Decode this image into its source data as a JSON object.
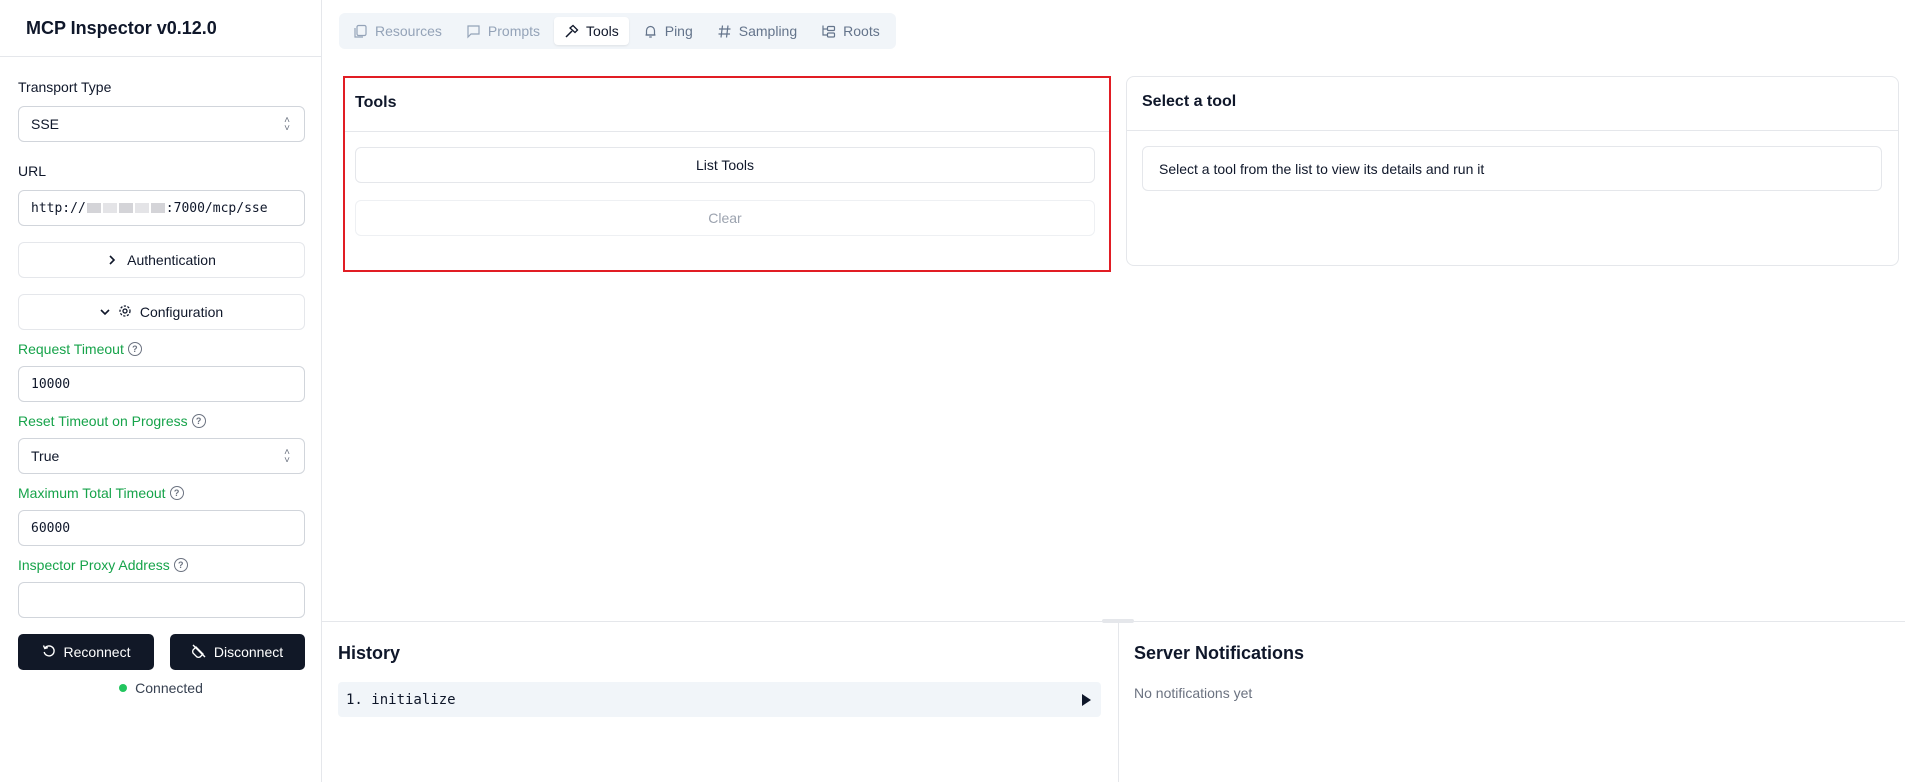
{
  "app": {
    "title": "MCP Inspector v0.12.0"
  },
  "sidebar": {
    "transport_label": "Transport Type",
    "transport_value": "SSE",
    "url_label": "URL",
    "url_prefix": "http://",
    "url_suffix": ":7000/mcp/sse",
    "authentication_label": "Authentication",
    "configuration_label": "Configuration",
    "request_timeout_label": "Request Timeout",
    "request_timeout_value": "10000",
    "reset_timeout_label": "Reset Timeout on Progress",
    "reset_timeout_value": "True",
    "max_timeout_label": "Maximum Total Timeout",
    "max_timeout_value": "60000",
    "proxy_label": "Inspector Proxy Address",
    "proxy_value": "",
    "reconnect_label": "Reconnect",
    "disconnect_label": "Disconnect",
    "status_text": "Connected"
  },
  "tabs": [
    {
      "label": "Resources",
      "state": "disabled"
    },
    {
      "label": "Prompts",
      "state": "disabled"
    },
    {
      "label": "Tools",
      "state": "active"
    },
    {
      "label": "Ping",
      "state": "enabled"
    },
    {
      "label": "Sampling",
      "state": "enabled"
    },
    {
      "label": "Roots",
      "state": "enabled"
    }
  ],
  "tools_panel": {
    "title": "Tools",
    "list_button": "List Tools",
    "clear_button": "Clear"
  },
  "select_panel": {
    "title": "Select a tool",
    "message": "Select a tool from the list to view its details and run it"
  },
  "history": {
    "title": "History",
    "items": [
      "1. initialize"
    ]
  },
  "notifications": {
    "title": "Server Notifications",
    "empty_text": "No notifications yet"
  },
  "colors": {
    "accent_green": "#16a34a",
    "highlight_red": "#e11d24",
    "dark_button": "#111827",
    "status_dot": "#22c55e"
  }
}
